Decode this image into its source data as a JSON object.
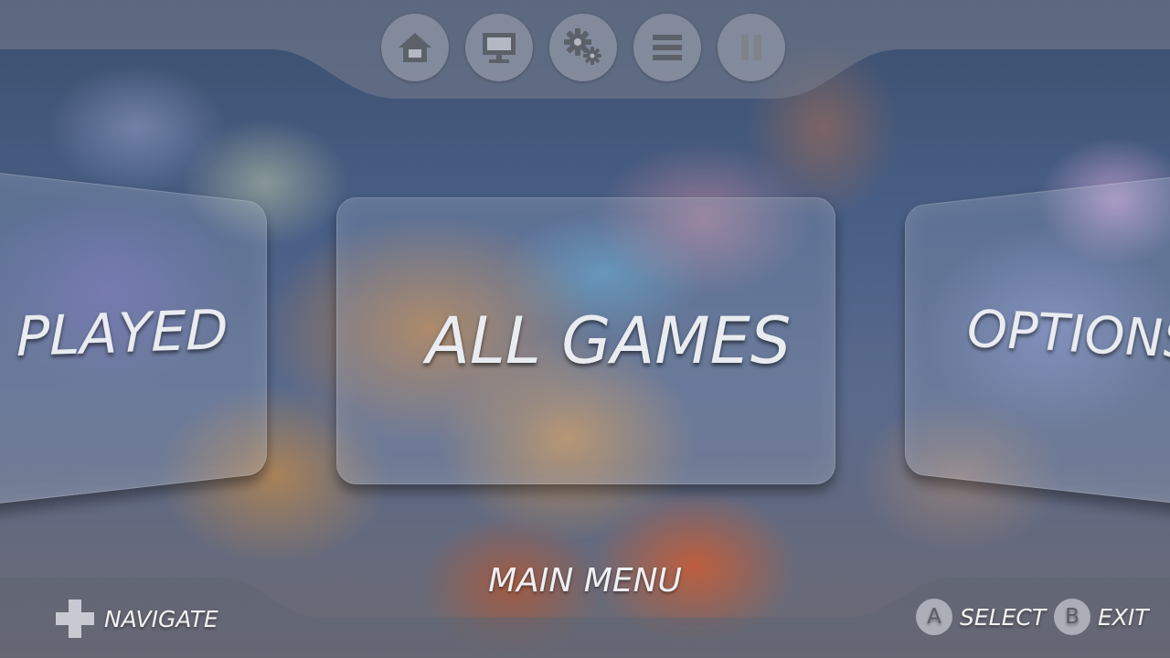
{
  "toolbar": {
    "icons": [
      "home-icon",
      "monitor-icon",
      "gears-icon",
      "list-icon",
      "pause-icon"
    ]
  },
  "carousel": {
    "left_label": "PLAYED",
    "center_label": "ALL GAMES",
    "right_label": "OPTIONS"
  },
  "footer": {
    "title": "MAIN MENU",
    "navigate_label": "NAVIGATE",
    "select_button": "A",
    "select_label": "SELECT",
    "exit_button": "B",
    "exit_label": "EXIT"
  }
}
